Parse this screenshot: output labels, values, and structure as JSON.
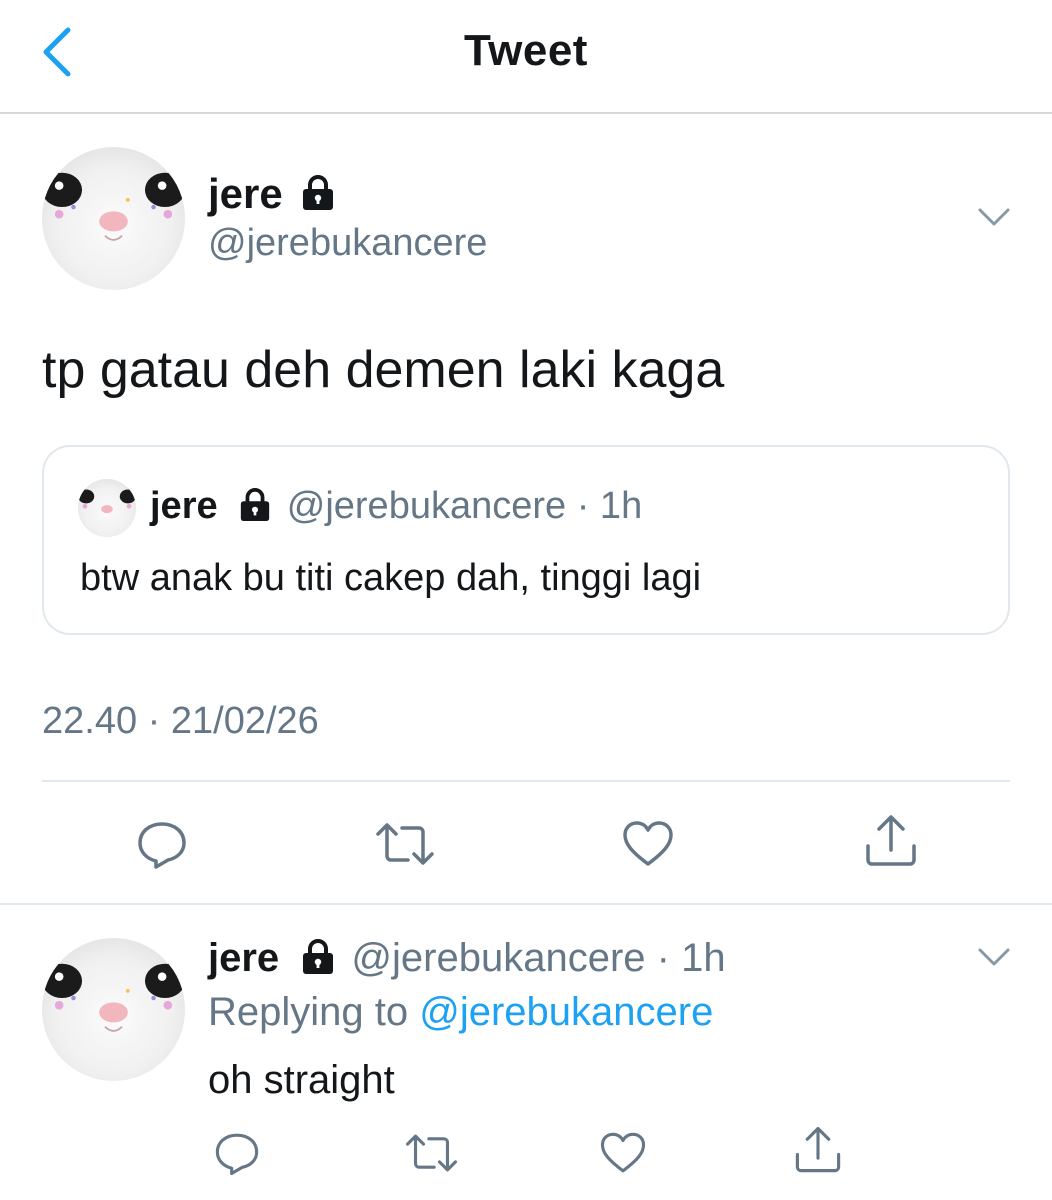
{
  "header": {
    "title": "Tweet"
  },
  "tweet": {
    "name": "jere",
    "handle": "@jerebukancere",
    "text": "tp gatau deh demen laki kaga",
    "quote": {
      "name": "jere",
      "handle": "@jerebukancere",
      "time": "· 1h",
      "text": "btw anak bu titi cakep dah, tinggi lagi"
    },
    "timestamp": "22.40 · 21/02/26",
    "actions": [
      "reply-icon",
      "retweet-icon",
      "like-icon",
      "share-icon"
    ]
  },
  "reply": {
    "name": "jere",
    "handle": "@jerebukancere",
    "time": "· 1h",
    "replying_prefix": "Replying to",
    "replying_to": "@jerebukancere",
    "text": "oh straight",
    "actions": [
      "reply-icon",
      "retweet-icon",
      "like-icon",
      "share-icon"
    ]
  },
  "colors": {
    "accent": "#1da1f2",
    "secondary_text": "#657786",
    "icon": "#657786",
    "border": "#e1e8ed"
  }
}
